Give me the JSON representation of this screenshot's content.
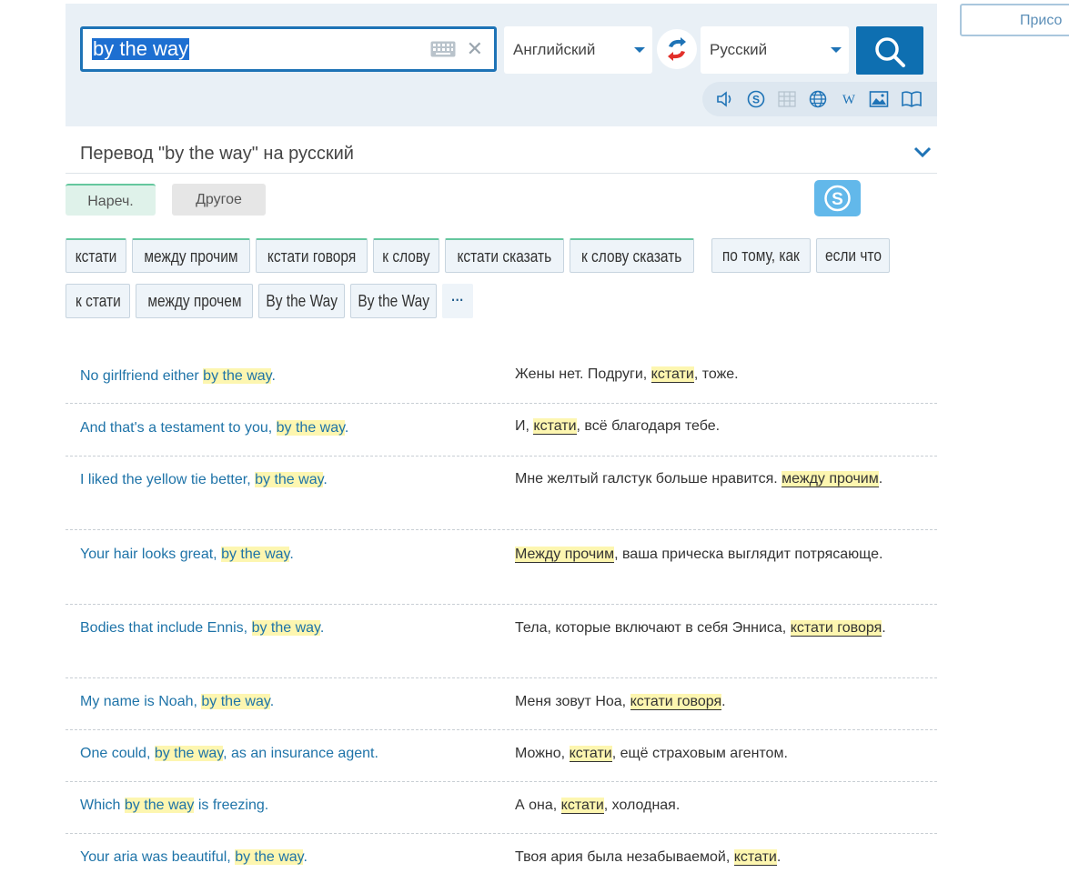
{
  "search": {
    "query": "by the way",
    "source_lang": "Английский",
    "target_lang": "Русский"
  },
  "top_right": {
    "join_label": "Присо"
  },
  "heading": {
    "title": "Перевод \"by the way\" на русский"
  },
  "pos_tabs": [
    {
      "label": "Нареч."
    },
    {
      "label": "Другое"
    }
  ],
  "translations": [
    {
      "label": "кстати"
    },
    {
      "label": "между прочим"
    },
    {
      "label": "кстати говоря"
    },
    {
      "label": "к слову"
    },
    {
      "label": "кстати сказать"
    },
    {
      "label": "к слову сказать"
    },
    {
      "label": "по тому, как"
    },
    {
      "label": "если что"
    },
    {
      "label": "к стати"
    },
    {
      "label": "между прочем"
    },
    {
      "label": "By the Way"
    },
    {
      "label": "By the Way"
    },
    {
      "label": "···"
    }
  ],
  "examples": [
    {
      "src": [
        "No girlfriend either ",
        "by the way",
        "."
      ],
      "tgt": [
        "Жены нет. Подруги, ",
        "кстати",
        ", тоже."
      ]
    },
    {
      "src": [
        "And that's a testament to you, ",
        "by the way",
        "."
      ],
      "tgt": [
        "И, ",
        "кстати",
        ", всё благодаря тебе."
      ]
    },
    {
      "src": [
        "I liked the yellow tie better, ",
        "by the way",
        "."
      ],
      "tgt": [
        "Мне желтый галстук больше нравится. ",
        "между прочим",
        "."
      ]
    },
    {
      "src": [
        "Your hair looks great, ",
        "by the way",
        "."
      ],
      "tgt": [
        "",
        "Между прочим",
        ", ваша прическа выглядит потрясающе."
      ]
    },
    {
      "src": [
        "Bodies that include Ennis, ",
        "by the way",
        "."
      ],
      "tgt": [
        "Тела, которые включают в себя Энниса, ",
        "кстати говоря",
        "."
      ]
    },
    {
      "src": [
        "My name is Noah, ",
        "by the way",
        "."
      ],
      "tgt": [
        "Меня зовут Ноа, ",
        "кстати говоря",
        "."
      ]
    },
    {
      "src": [
        "One could, ",
        "by the way",
        ", as an insurance agent."
      ],
      "tgt": [
        "Можно, ",
        "кстати",
        ", ещё страховым агентом."
      ]
    },
    {
      "src": [
        "Which ",
        "by the way",
        " is freezing."
      ],
      "tgt": [
        "А она, ",
        "кстати",
        ", холодная."
      ]
    },
    {
      "src": [
        "Your aria was beautiful, ",
        "by the way",
        "."
      ],
      "tgt": [
        "Твоя ария была незабываемой, ",
        "кстати",
        "."
      ]
    }
  ]
}
